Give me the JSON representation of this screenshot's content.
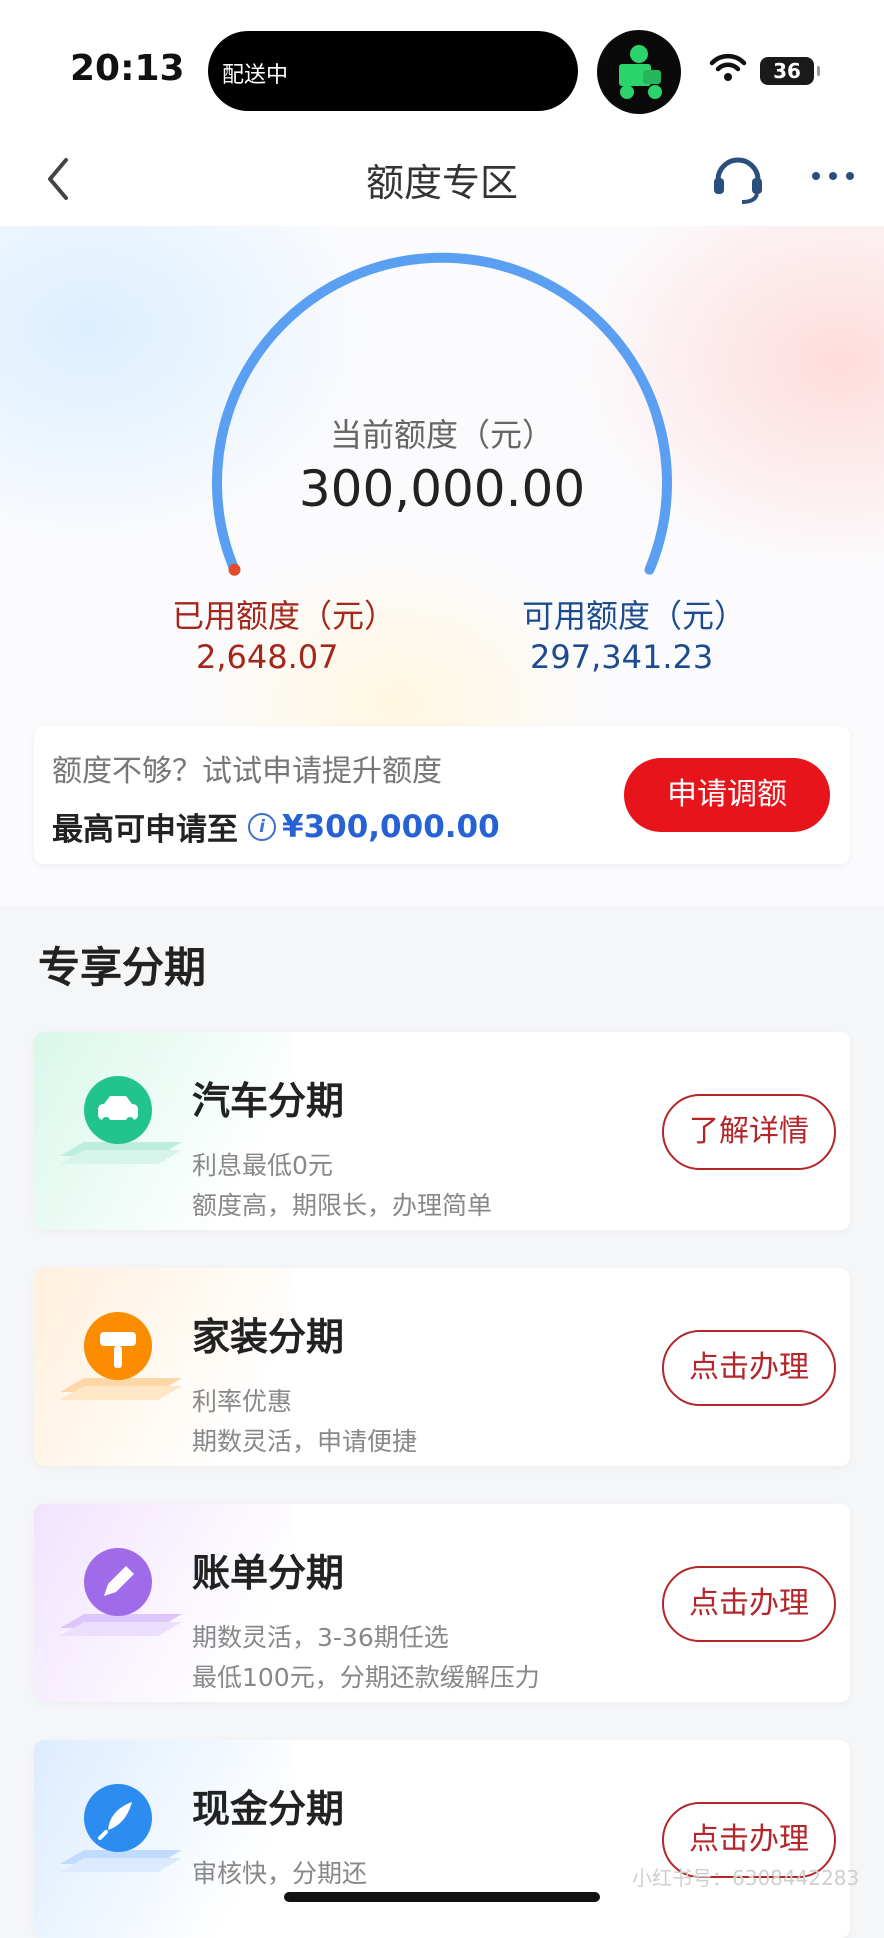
{
  "status_bar": {
    "time": "20:13",
    "island_text": "配送中",
    "battery": "36"
  },
  "nav": {
    "title": "额度专区"
  },
  "credit": {
    "current_label": "当前额度（元）",
    "current_value": "300,000.00",
    "used_label": "已用额度（元）",
    "used_value": "2,648.07",
    "available_label": "可用额度（元）",
    "available_value": "297,341.23",
    "used_fraction": 0.0088
  },
  "promo": {
    "line1": "额度不够？试试申请提升额度",
    "line2_prefix": "最高可申请至",
    "amount": "¥300,000.00",
    "button": "申请调额"
  },
  "section_title": "专享分期",
  "cards": [
    {
      "title": "汽车分期",
      "line1": "利息最低0元",
      "line2": "额度高，期限长，办理简单",
      "button": "了解详情",
      "icon": "car-icon",
      "accent": "#23c38e"
    },
    {
      "title": "家装分期",
      "line1": "利率优惠",
      "line2": "期数灵活，申请便捷",
      "button": "点击办理",
      "icon": "paint-roller-icon",
      "accent": "#fb8c00"
    },
    {
      "title": "账单分期",
      "line1": "期数灵活，3-36期任选",
      "line2": "最低100元，分期还款缓解压力",
      "button": "点击办理",
      "icon": "pencil-icon",
      "accent": "#a06be8"
    },
    {
      "title": "现金分期",
      "line1": "审核快，分期还",
      "line2": "",
      "button": "点击办理",
      "icon": "rocket-icon",
      "accent": "#2d8cf0"
    }
  ],
  "colors": {
    "gauge_arc": "#5b9ff2",
    "used_dot": "#e24a2c",
    "used_text": "#a3271a",
    "available_text": "#1d4b8f",
    "primary_button": "#e8141c",
    "outline_button": "#b4262a"
  },
  "watermark": "小红书号：6308442283"
}
